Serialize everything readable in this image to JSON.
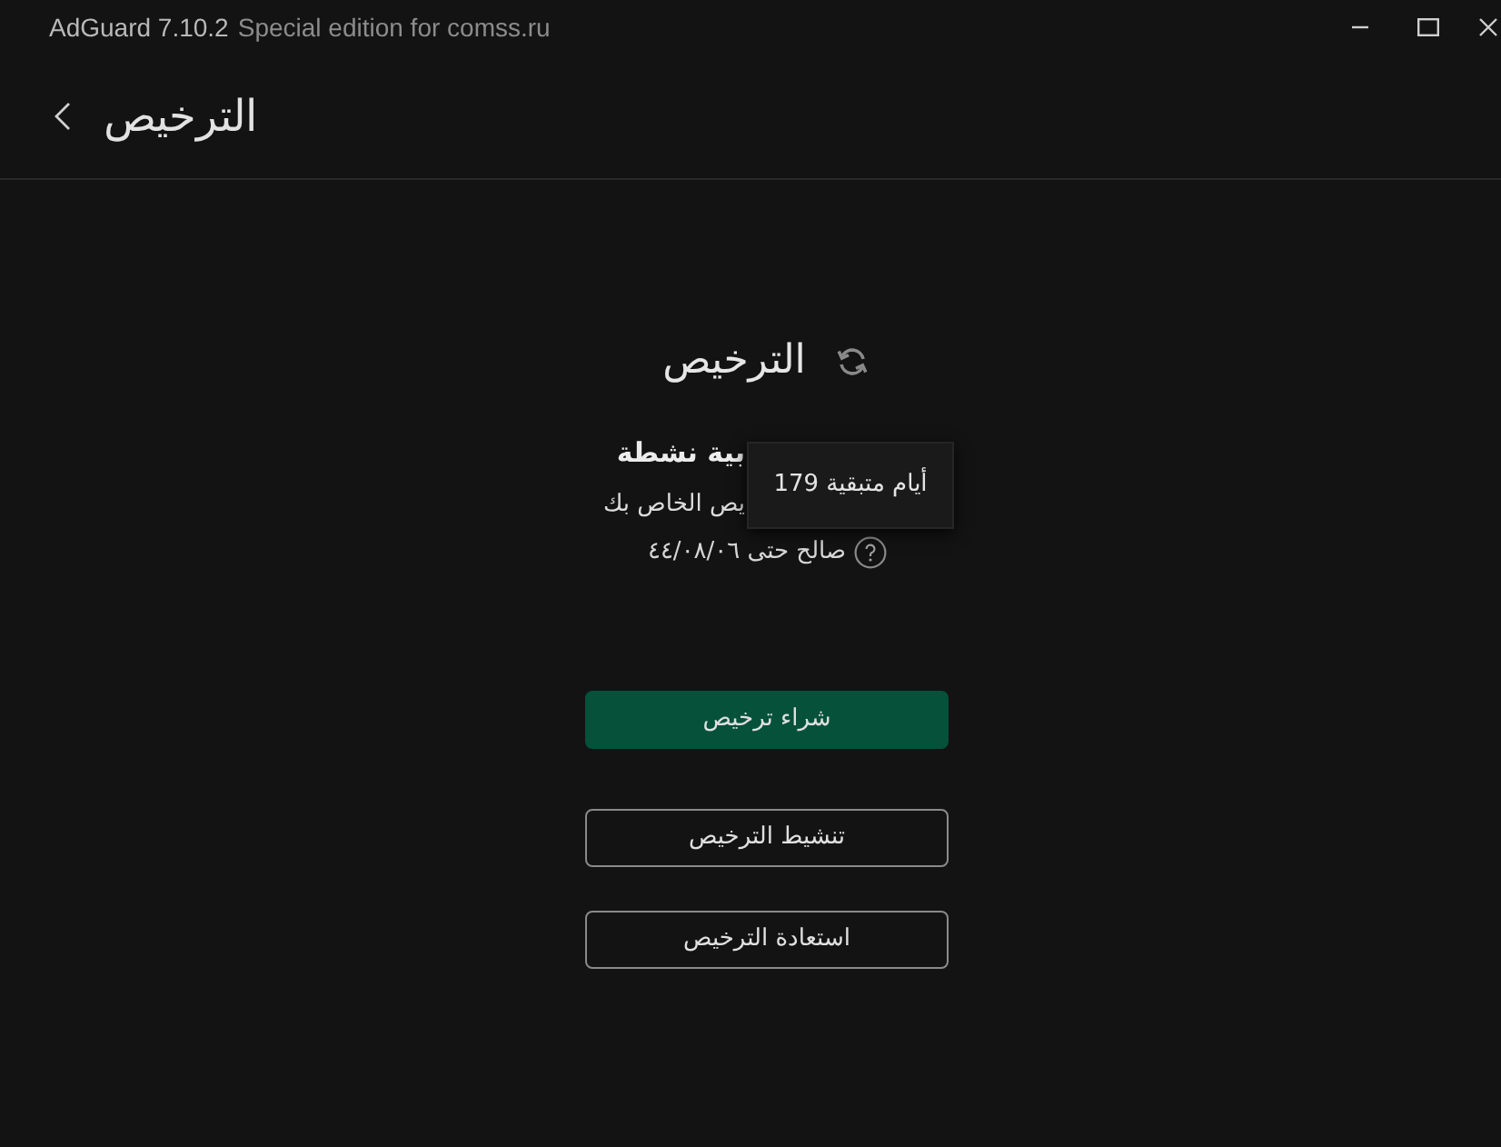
{
  "window": {
    "title": "AdGuard 7.10.2",
    "subtitle": "Special edition for comss.ru",
    "controls": [
      {
        "kind": "minimize"
      },
      {
        "kind": "maximize"
      },
      {
        "kind": "close"
      }
    ]
  },
  "header": {
    "title": "الترخيص"
  },
  "license": {
    "title": "الترخيص",
    "status": "بية نشطة",
    "description": "يص الخاص بك",
    "validity": "صالح حتى ٤٤/٠٨/٠٦"
  },
  "tooltip": {
    "text": "أيام متبقية 179"
  },
  "buttons": [
    {
      "label": "شراء ترخيص",
      "kind": "primary"
    },
    {
      "label": "تنشيط الترخيص",
      "kind": "outline"
    },
    {
      "label": "استعادة الترخيص",
      "kind": "outline"
    }
  ]
}
